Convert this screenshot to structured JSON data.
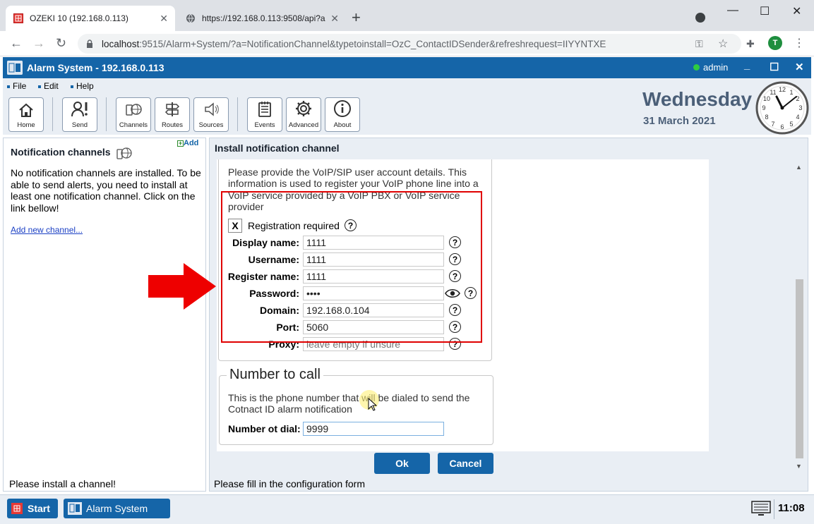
{
  "browser": {
    "tabs": [
      {
        "title": "OZEKI 10 (192.168.0.113)",
        "active": true
      },
      {
        "title": "https://192.168.0.113:9508/api?a",
        "active": false
      }
    ],
    "url_host": "localhost",
    "url_rest": ":9515/Alarm+System/?a=NotificationChannel&typetoinstall=OzC_ContactIDSender&refreshrequest=IIYYNTXE",
    "profile_initial": "T"
  },
  "app": {
    "title": "Alarm System - 192.168.0.113",
    "user": "admin",
    "accent": "#1565a8"
  },
  "menu": [
    "File",
    "Edit",
    "Help"
  ],
  "toolbar": {
    "buttons": [
      "Home",
      "Send",
      "Channels",
      "Routes",
      "Sources",
      "Events",
      "Advanced",
      "About"
    ],
    "day": "Wednesday",
    "date": "31 March 2021"
  },
  "left_panel": {
    "title": "Notification channels",
    "add_label": "Add",
    "message": "No notification channels are installed. To be able to send alerts, you need to install at least one notification channel. Click on the link bellow!",
    "link": "Add new channel...",
    "status": "Please install a channel!"
  },
  "right_panel": {
    "title": "Install notification channel",
    "description": "Please provide the VoIP/SIP user account details. This information is used to register your VoIP phone line into a VoIP service provided by a VoIP PBX or VoIP service provider",
    "registration": {
      "label": "Registration required",
      "checked_mark": "X"
    },
    "fields": [
      {
        "label": "Display name:",
        "value": "1111",
        "placeholder": ""
      },
      {
        "label": "Username:",
        "value": "1111",
        "placeholder": ""
      },
      {
        "label": "Register name:",
        "value": "1111",
        "placeholder": ""
      },
      {
        "label": "Password:",
        "value": "••••",
        "placeholder": ""
      },
      {
        "label": "Domain:",
        "value": "192.168.0.104",
        "placeholder": ""
      },
      {
        "label": "Port:",
        "value": "5060",
        "placeholder": ""
      },
      {
        "label": "Proxy:",
        "value": "",
        "placeholder": "leave empty if unsure"
      }
    ],
    "call_section": {
      "legend": "Number to call",
      "description": "This is the phone number that will be dialed to send the Cotnact ID alarm notification",
      "label": "Number ot dial:",
      "value": "9999"
    },
    "ok_label": "Ok",
    "cancel_label": "Cancel",
    "status": "Please fill in the configuration form"
  },
  "taskbar": {
    "start_label": "Start",
    "task_label": "Alarm System",
    "time": "11:08"
  },
  "icons": [
    "lock-icon",
    "key-icon",
    "star-icon",
    "puzzle-icon",
    "home-icon",
    "send-icon",
    "channels-icon",
    "routes-icon",
    "sources-icon",
    "events-icon",
    "gear-icon",
    "info-icon",
    "clock-icon",
    "eye-icon",
    "help-icon",
    "red-arrow-icon"
  ]
}
